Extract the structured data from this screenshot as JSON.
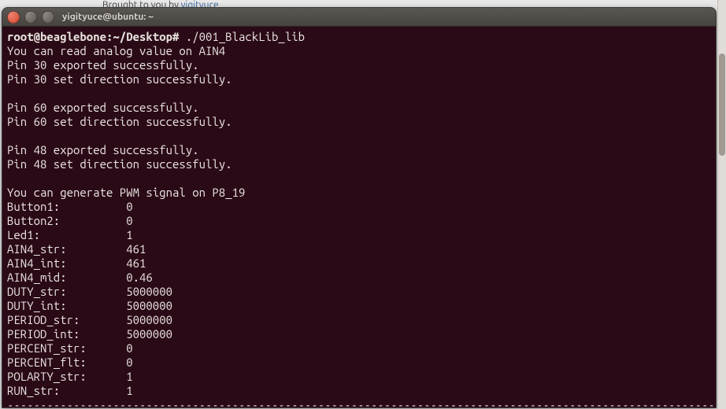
{
  "bg": {
    "prefix": "Brought to you by ",
    "link": "yigityuce"
  },
  "window": {
    "title": "yigityuce@ubuntu: ~"
  },
  "prompt": {
    "text": "root@beaglebone:~/Desktop#",
    "cmd": "./001_BlackLib_lib"
  },
  "lines_top": [
    "You can read analog value on AIN4",
    "Pin 30 exported successfully.",
    "Pin 30 set direction successfully.",
    "",
    "Pin 60 exported successfully.",
    "Pin 60 set direction successfully.",
    "",
    "Pin 48 exported successfully.",
    "Pin 48 set direction successfully.",
    "",
    "You can generate PWM signal on P8_19"
  ],
  "kv": [
    {
      "label": "Button1:",
      "value": "0"
    },
    {
      "label": "Button2:",
      "value": "0"
    },
    {
      "label": "Led1:",
      "value": "1"
    },
    {
      "label": "AIN4_str:",
      "value": "461"
    },
    {
      "label": "AIN4_int:",
      "value": "461"
    },
    {
      "label": "AIN4_mid:",
      "value": "0.46"
    },
    {
      "label": "DUTY_str:",
      "value": "5000000"
    },
    {
      "label": "DUTY_int:",
      "value": "5000000"
    },
    {
      "label": "PERIOD_str:",
      "value": "5000000"
    },
    {
      "label": "PERIOD_int:",
      "value": "5000000"
    },
    {
      "label": "PERCENT_str:",
      "value": "0"
    },
    {
      "label": "PERCENT_flt:",
      "value": "0"
    },
    {
      "label": "POLARTY_str:",
      "value": "1"
    },
    {
      "label": "RUN_str:",
      "value": "1"
    }
  ],
  "separator": "---------------------------------------------------------------------------------------------------------------"
}
